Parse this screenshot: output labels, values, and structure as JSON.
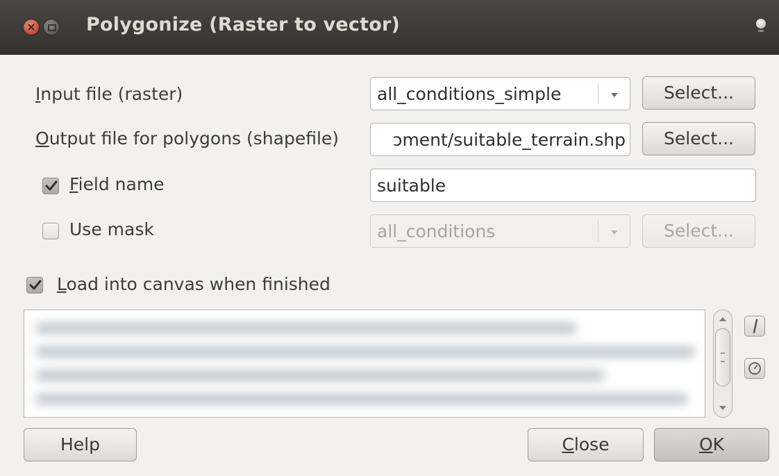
{
  "window": {
    "title": "Polygonize (Raster to vector)"
  },
  "input": {
    "label_mnemonic": "I",
    "label_rest": "nput file (raster)",
    "value": "all_conditions_simple",
    "select_label": "Select..."
  },
  "output": {
    "label_mnemonic": "O",
    "label_rest": "utput file for polygons (shapefile)",
    "value": "ɔment/suitable_terrain.shp",
    "select_label": "Select..."
  },
  "field_name": {
    "checked": true,
    "label_mnemonic": "F",
    "label_rest": "ield name",
    "value": "suitable"
  },
  "use_mask": {
    "checked": false,
    "label": "Use mask",
    "value": "all_conditions",
    "select_label": "Select..."
  },
  "load_canvas": {
    "checked": true,
    "label_mnemonic": "L",
    "label_rest": "oad into canvas when finished"
  },
  "buttons": {
    "help": "Help",
    "close_mnemonic": "C",
    "close_rest": "lose",
    "ok_mnemonic": "O",
    "ok_rest": "K"
  },
  "icons": {
    "close": "close-icon",
    "minimize": "minimize-icon",
    "window_menu": "window-menu-icon",
    "edit": "pencil-icon",
    "reset": "reset-icon",
    "dropdown": "chevron-down-icon",
    "check": "check-icon"
  },
  "colors": {
    "titlebar": "#3b3a36",
    "window_bg": "#f2f1f0",
    "close_button": "#c9543c"
  }
}
